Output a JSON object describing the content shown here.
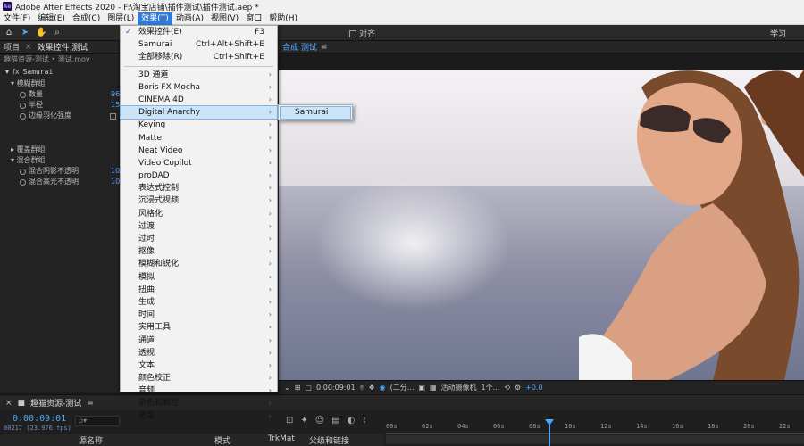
{
  "window": {
    "title": "Adobe After Effects 2020 - F:\\淘宝店铺\\插件测试\\插件测试.aep *"
  },
  "menubar": [
    "文件(F)",
    "编辑(E)",
    "合成(C)",
    "图层(L)",
    "效果(T)",
    "动画(A)",
    "视图(V)",
    "窗口",
    "帮助(H)"
  ],
  "toolbar": {
    "snap_label": "对齐",
    "learn_label": "学习"
  },
  "effects_panel": {
    "tab_project": "项目",
    "tab_effects": "效果控件 测试",
    "breadcrumb": "趣猫资源-测试 • 测试.mov",
    "effect_name": "Samurai",
    "fx_label": "fx",
    "groups": {
      "blur": "模糊群组",
      "overlay": "覆盖群组",
      "blend": "混合群组"
    },
    "params": [
      {
        "label": "数量",
        "value": "96"
      },
      {
        "label": "半径",
        "value": "15"
      },
      {
        "label": "边缘羽化强度",
        "value": ""
      }
    ],
    "blend_params": [
      {
        "label": "混合阴影不透明",
        "value": "10"
      },
      {
        "label": "混合高光不透明",
        "value": "10"
      }
    ]
  },
  "comp_panel": {
    "tab_label": "合成 测试",
    "menu_icon": "≡"
  },
  "viewer_controls": {
    "timecode": "0:00:09:01",
    "resolution": "(二分...",
    "camera": "活动摄像机",
    "views": "1个...",
    "exposure": "+0.0"
  },
  "timeline": {
    "tab_label": "趣猫资源-测试",
    "menu_icon": "≡",
    "timecode": "0:00:09:01",
    "fps": "00217 (23.976 fps)",
    "search_placeholder": "ρ▾",
    "col_source": "源名称",
    "col_mode": "模式",
    "col_trkmat": "TrkMat",
    "col_parent": "父级和链接",
    "ruler": [
      "00s",
      "02s",
      "04s",
      "06s",
      "08s",
      "10s",
      "12s",
      "14s",
      "16s",
      "18s",
      "20s",
      "22s"
    ]
  },
  "dropdown": {
    "items": [
      {
        "label": "效果控件(E)",
        "shortcut": "F3",
        "checked": true
      },
      {
        "label": "Samurai",
        "shortcut": "Ctrl+Alt+Shift+E"
      },
      {
        "label": "全部移除(R)",
        "shortcut": "Ctrl+Shift+E"
      }
    ],
    "categories": [
      "3D 通道",
      "Boris FX Mocha",
      "CINEMA 4D",
      "Digital Anarchy",
      "Keying",
      "Matte",
      "Neat Video",
      "Video Copilot",
      "proDAD",
      "表达式控制",
      "沉浸式视频",
      "风格化",
      "过渡",
      "过时",
      "抠像",
      "模糊和锐化",
      "模拟",
      "扭曲",
      "生成",
      "时间",
      "实用工具",
      "通道",
      "透视",
      "文本",
      "颜色校正",
      "音频",
      "杂色和颗粒",
      "遮罩"
    ],
    "hover_index": 3
  },
  "submenu": {
    "item": "Samurai"
  }
}
